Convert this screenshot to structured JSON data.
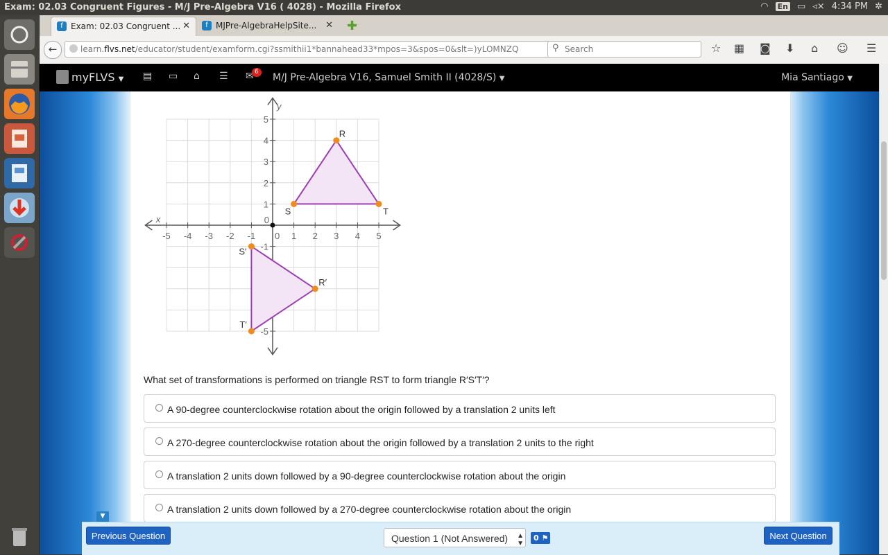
{
  "os": {
    "window_title": "Exam: 02.03 Congruent Figures - M/J Pre-Algebra V16 ( 4028) - Mozilla Firefox",
    "keyboard_layout": "En",
    "clock": "4:34 PM"
  },
  "browser": {
    "tabs": [
      {
        "label": "Exam: 02.03 Congruent ...",
        "active": true
      },
      {
        "label": "MJPre-AlgebraHelpSite...",
        "active": false
      }
    ],
    "url_prefix": "learn.",
    "url_host": "flvs.net",
    "url_path": "/educator/student/examform.cgi?ssmithii1*bannahead33*mpos=3&spos=0&slt=)yLOMNZQ",
    "search_placeholder": "Search"
  },
  "site": {
    "brand": "myFLVS",
    "mail_count": "6",
    "course": "M/J Pre-Algebra V16, Samuel Smith II (4028/S)",
    "user": "Mia Santiago"
  },
  "graph": {
    "x_axis_label": "x",
    "y_axis_label": "y",
    "x_ticks": [
      "-5",
      "-4",
      "-3",
      "-2",
      "-1",
      "0",
      "1",
      "2",
      "3",
      "4",
      "5"
    ],
    "y_ticks": [
      "5",
      "4",
      "3",
      "2",
      "1",
      "0",
      "-1",
      "-2",
      "-3",
      "-4",
      "-5"
    ],
    "triangle_rst": {
      "R": [
        3,
        4
      ],
      "S": [
        1,
        1
      ],
      "T": [
        5,
        1
      ]
    },
    "triangle_rst_prime": {
      "R′": [
        2,
        -3
      ],
      "S′": [
        -1,
        -1
      ],
      "T′": [
        -1,
        -5
      ]
    },
    "labels": {
      "R": "R",
      "S": "S",
      "T": "T",
      "Rp": "R′",
      "Sp": "S′",
      "Tp": "T′"
    },
    "colors": {
      "triangle_stroke": "#9b3fb5",
      "triangle_fill": "#f3e4f6",
      "vertex": "#f08c1e",
      "grid": "#dcdcdc",
      "axis": "#555555"
    }
  },
  "question": "What set of transformations is performed on triangle RST to form triangle R′S′T′?",
  "options": [
    "A 90-degree counterclockwise rotation about the origin followed by a translation 2 units left",
    "A 270-degree counterclockwise rotation about the origin followed by a translation 2 units to the right",
    "A translation 2 units down followed by a 90-degree counterclockwise rotation about the origin",
    "A translation 2 units down followed by a 270-degree counterclockwise rotation about the origin"
  ],
  "footer": {
    "prev_label": "Previous Question",
    "next_label": "Next Question",
    "question_select": "Question 1 (Not Answered)",
    "flag_count": "0"
  }
}
